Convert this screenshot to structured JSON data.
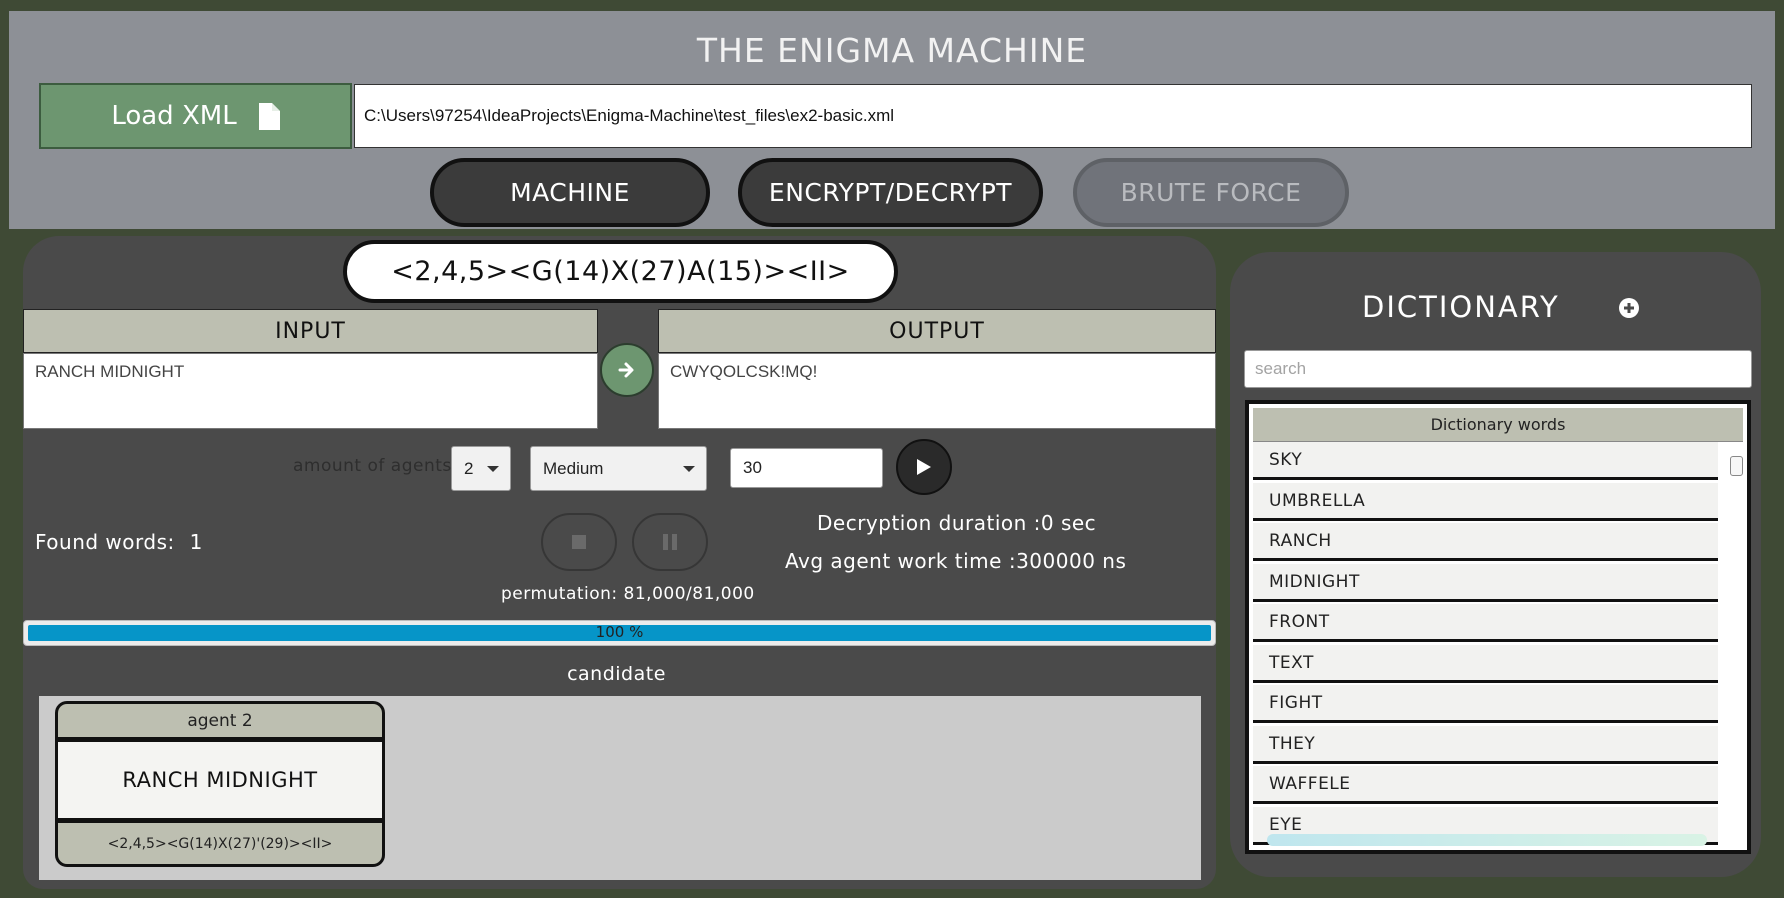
{
  "header": {
    "title": "THE ENIGMA MACHINE",
    "load_label": "Load XML",
    "file_path": "C:\\Users\\97254\\IdeaProjects\\Enigma-Machine\\test_files\\ex2-basic.xml",
    "tabs": [
      {
        "label": "MACHINE",
        "state": "normal"
      },
      {
        "label": "ENCRYPT/DECRYPT",
        "state": "normal"
      },
      {
        "label": "BRUTE FORCE",
        "state": "disabled"
      }
    ]
  },
  "main": {
    "configuration": "<2,4,5><G(14)X(27)A(15)><II>",
    "input": {
      "header": "INPUT",
      "value": "RANCH MIDNIGHT"
    },
    "output": {
      "header": "OUTPUT",
      "value": "CWYQOLCSK!MQ!"
    },
    "agents_label": "amount of agents:",
    "agents_value": "2",
    "level_value": "Medium",
    "task_size_value": "30",
    "found_words_label": "Found words:",
    "found_words_count": "1",
    "decryption_duration": "Decryption duration :0 sec",
    "avg_agent_time": "Avg agent work time :300000 ns",
    "permutation": "permutation: 81,000/81,000",
    "progress_fraction": 1.0,
    "progress_text": "100 %",
    "candidate_title": "candidate",
    "candidates": [
      {
        "agent": "agent 2",
        "word": "RANCH MIDNIGHT",
        "config": "<2,4,5><G(14)X(27)'(29)><II>"
      }
    ]
  },
  "dictionary": {
    "title": "DICTIONARY",
    "search_placeholder": "search",
    "column_header": "Dictionary words",
    "words": [
      "SKY",
      "UMBRELLA",
      "RANCH",
      "MIDNIGHT",
      "FRONT",
      "TEXT",
      "FIGHT",
      "THEY",
      "WAFFELE",
      "EYE"
    ]
  },
  "colors": {
    "accent_green": "#6d9670",
    "progress_blue": "#0695c8",
    "header_bg": "#8d9096",
    "panel_bg": "#4a4a4a",
    "label_tan": "#bdbfb1"
  }
}
